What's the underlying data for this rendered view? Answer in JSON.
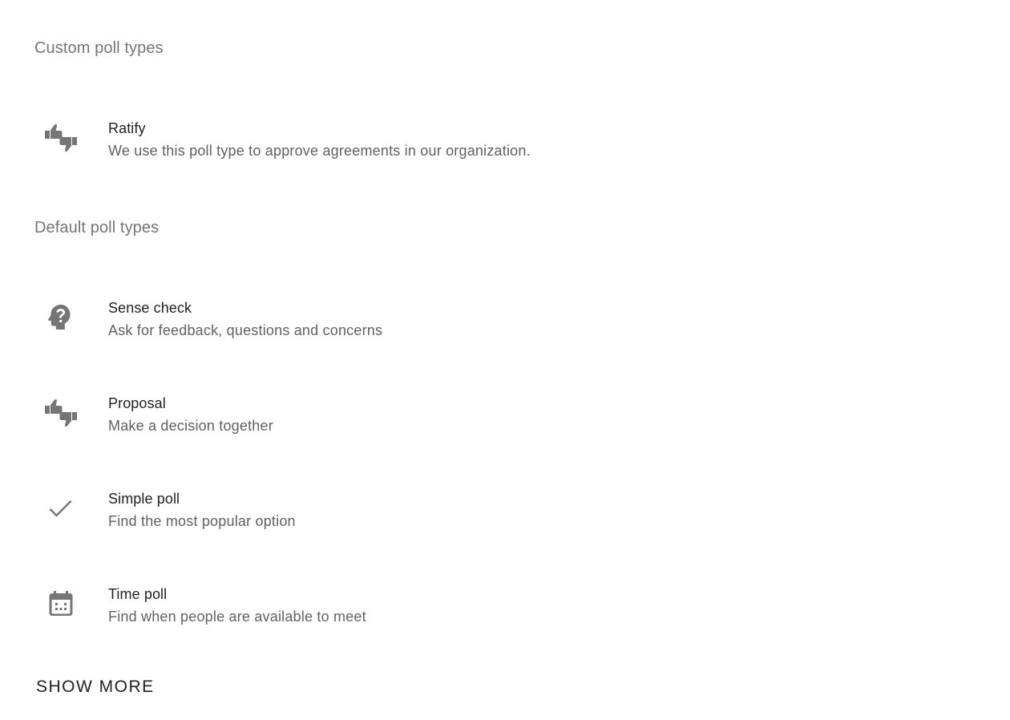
{
  "custom_section": {
    "heading": "Custom poll types",
    "items": [
      {
        "title": "Ratify",
        "description": "We use this poll type to approve agreements in our organization.",
        "icon": "thumbs-up-down-icon"
      }
    ]
  },
  "default_section": {
    "heading": "Default poll types",
    "items": [
      {
        "title": "Sense check",
        "description": "Ask for feedback, questions and concerns",
        "icon": "head-question-icon"
      },
      {
        "title": "Proposal",
        "description": "Make a decision together",
        "icon": "thumbs-up-down-icon"
      },
      {
        "title": "Simple poll",
        "description": "Find the most popular option",
        "icon": "check-icon"
      },
      {
        "title": "Time poll",
        "description": "Find when people are available to meet",
        "icon": "calendar-icon"
      }
    ]
  },
  "show_more_label": "SHOW MORE",
  "colors": {
    "heading": "#757575",
    "title": "#212121",
    "description": "#616161",
    "icon": "#757575"
  }
}
